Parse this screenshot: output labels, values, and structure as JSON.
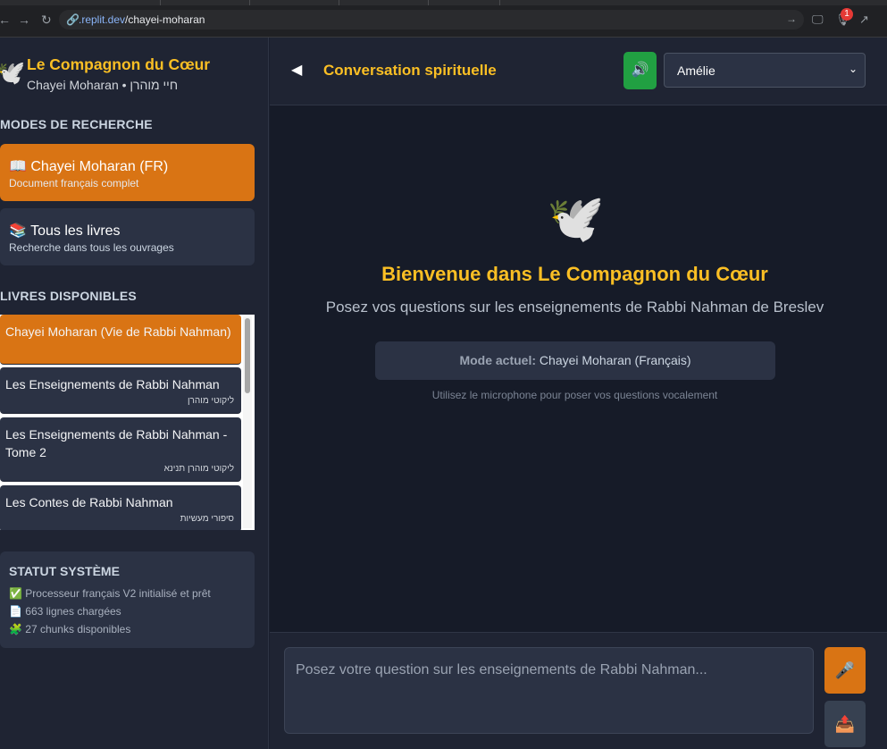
{
  "browser": {
    "url_domain": ".replit.dev",
    "url_path": "/chayei-moharan",
    "notification_count": "1",
    "icons": [
      "back-arrow-icon",
      "forward-arrow-icon",
      "reload-icon",
      "link-icon",
      "go-arrow-icon",
      "monitor-icon",
      "microphone-icon",
      "open-external-icon"
    ]
  },
  "sidebar": {
    "title": "Le Compagnon du Cœur",
    "subtitle": "Chayei Moharan • חיי מוהרן",
    "modes_heading": "MODES DE RECHERCHE",
    "modes": [
      {
        "icon": "📖",
        "title": "Chayei Moharan (FR)",
        "desc": "Document français complet",
        "active": true
      },
      {
        "icon": "📚",
        "title": "Tous les livres",
        "desc": "Recherche dans tous les ouvrages",
        "active": false
      }
    ],
    "books_heading": "LIVRES DISPONIBLES",
    "books": [
      {
        "name": "Chayei Moharan (Vie de Rabbi Nahman)",
        "hebrew": "",
        "active": true
      },
      {
        "name": "Les Enseignements de Rabbi Nahman",
        "hebrew": "ליקוטי מוהרן",
        "active": false
      },
      {
        "name": "Les Enseignements de Rabbi Nahman - Tome 2",
        "hebrew": "ליקוטי מוהרן תנינא",
        "active": false
      },
      {
        "name": "Les Contes de Rabbi Nahman",
        "hebrew": "סיפורי מעשיות",
        "active": false
      }
    ],
    "status": {
      "heading": "STATUT SYSTÈME",
      "lines": [
        "✅ Processeur français V2 initialisé et prêt",
        "📄 663 lignes chargées",
        "🧩 27 chunks disponibles"
      ]
    }
  },
  "header": {
    "back_icon": "◀",
    "title": "Conversation spirituelle",
    "speaker_icon": "🔊",
    "voice_selected": "Amélie"
  },
  "chat": {
    "dove": "🕊️",
    "welcome": "Bienvenue dans Le Compagnon du Cœur",
    "subtitle": "Posez vos questions sur les enseignements de Rabbi Nahman de Breslev",
    "mode_label": "Mode actuel:",
    "mode_value": "Chayei Moharan (Français)",
    "hint": "Utilisez le microphone pour poser vos questions vocalement"
  },
  "input": {
    "placeholder": "Posez votre question sur les enseignements de Rabbi Nahman...",
    "mic_icon": "🎤",
    "send_icon": "📤"
  }
}
